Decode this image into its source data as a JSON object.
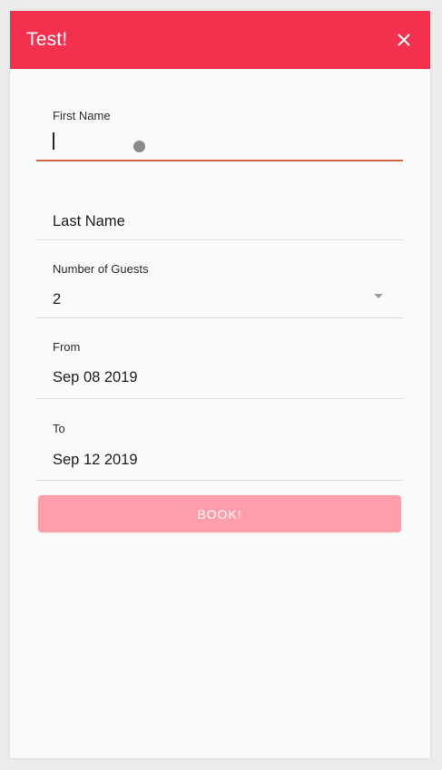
{
  "header": {
    "title": "Test!",
    "close_icon": "close-icon",
    "color": "#f4304f"
  },
  "form": {
    "first_name": {
      "label": "First Name",
      "value": ""
    },
    "last_name": {
      "placeholder": "Last Name"
    },
    "guests": {
      "label": "Number of Guests",
      "value": "2"
    },
    "from": {
      "label": "From",
      "value": "Sep 08 2019"
    },
    "to": {
      "label": "To",
      "value": "Sep 12 2019"
    },
    "submit_label": "BOOK!",
    "submit_color": "#ff9daa",
    "active_underline_color": "#d9603f"
  }
}
